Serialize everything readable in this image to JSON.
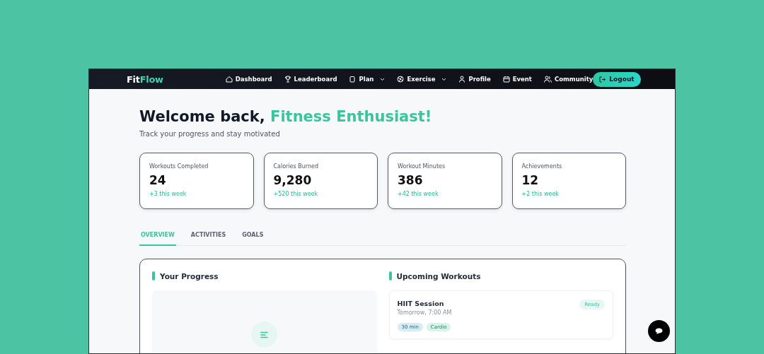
{
  "logo": {
    "first": "Fit",
    "second": "Flow"
  },
  "nav": [
    {
      "label": "Dashboard",
      "has_menu": false
    },
    {
      "label": "Leaderboard",
      "has_menu": false
    },
    {
      "label": "Plan",
      "has_menu": true
    },
    {
      "label": "Exercise",
      "has_menu": true
    },
    {
      "label": "Profile",
      "has_menu": false
    },
    {
      "label": "Event",
      "has_menu": false
    },
    {
      "label": "Community",
      "has_menu": false
    }
  ],
  "logout": "Logout",
  "welcome": {
    "text": "Welcome back, ",
    "name": "Fitness Enthusiast!",
    "subtitle": "Track your progress and stay motivated"
  },
  "stats": [
    {
      "label": "Workouts Completed",
      "value": "24",
      "change": "+3 this week"
    },
    {
      "label": "Calories Burned",
      "value": "9,280",
      "change": "+520 this week"
    },
    {
      "label": "Workout Minutes",
      "value": "386",
      "change": "+42 this week"
    },
    {
      "label": "Achievements",
      "value": "12",
      "change": "+2 this week"
    }
  ],
  "tabs": [
    {
      "label": "OVERVIEW",
      "selected": true
    },
    {
      "label": "ACTIVITIES",
      "selected": false
    },
    {
      "label": "GOALS",
      "selected": false
    }
  ],
  "progress": {
    "title": "Your Progress"
  },
  "upcoming": {
    "title": "Upcoming Workouts",
    "workouts": [
      {
        "title": "HIIT Session",
        "time": "Tomorrow, 7:00 AM",
        "status": "Ready",
        "tags": [
          {
            "text": "30 min",
            "color": "#d8ebf3"
          },
          {
            "text": "Cardio",
            "color": "#d9f3ea"
          }
        ]
      }
    ]
  }
}
